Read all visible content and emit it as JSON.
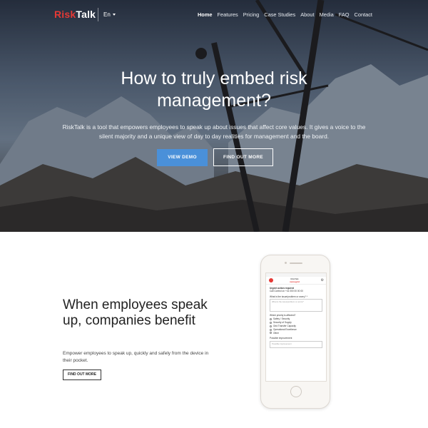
{
  "nav": {
    "logo_red": "Risk",
    "logo_white": "Talk",
    "language": "En",
    "items": [
      {
        "label": "Home",
        "active": true
      },
      {
        "label": "Features",
        "active": false
      },
      {
        "label": "Pricing",
        "active": false
      },
      {
        "label": "Case Studies",
        "active": false
      },
      {
        "label": "About",
        "active": false
      },
      {
        "label": "Media",
        "active": false
      },
      {
        "label": "FAQ",
        "active": false
      },
      {
        "label": "Contact",
        "active": false
      }
    ]
  },
  "hero": {
    "title_line1": "How to truly embed risk",
    "title_line2": "management?",
    "text": "RiskTalk is a tool that empowers employees to speak up about issues that affect core values. It gives a voice to the silent majority and a unique view of day to day realities for management and the board.",
    "btn_demo": "VIEW DEMO",
    "btn_find": "FIND OUT MORE"
  },
  "section": {
    "title": "When employees speak up, companies benefit",
    "text": "Empower employees to speak up, quickly and safely from the device in their pocket.",
    "btn": "FIND OUT MORE"
  },
  "phone": {
    "brand_top": "RiskTalk",
    "brand_bottom": "swissgrid",
    "urgent": "Urgent action required",
    "call": "Call Control on +41 000 00 00 00",
    "q1": "What is the issue/problem or worry? *",
    "q1_placeholder": "What is the issue/problem or worry?",
    "q2": "Which priority is affected?",
    "options": [
      "Safety / Security",
      "Security of Supply",
      "Grid Transfer Capacity",
      "Operational Excellence",
      "Other"
    ],
    "q3": "Possible improvement",
    "q3_placeholder": "Possible improvement"
  },
  "colors": {
    "accent_red": "#e53935",
    "accent_blue": "#4a90d9"
  }
}
